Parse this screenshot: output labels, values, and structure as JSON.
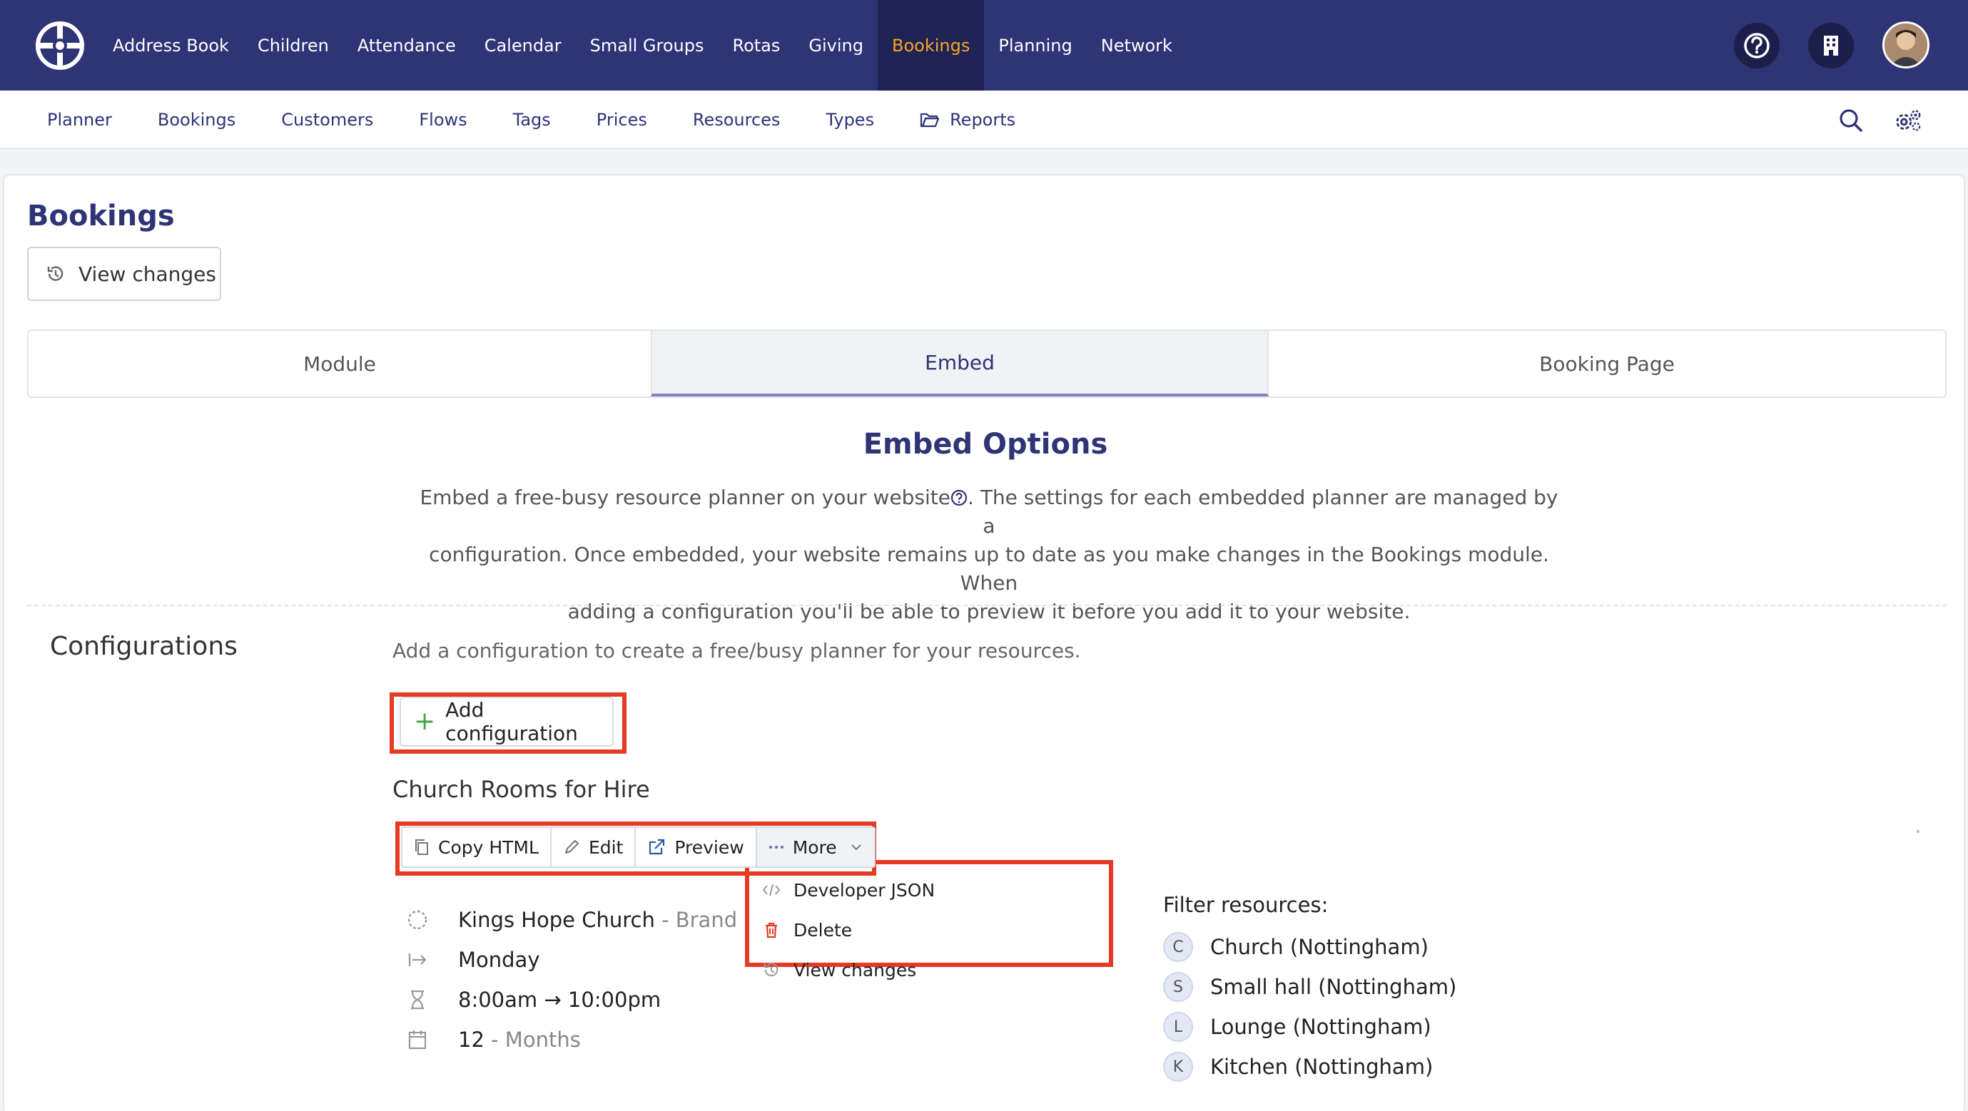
{
  "topnav": {
    "items": [
      "Address Book",
      "Children",
      "Attendance",
      "Calendar",
      "Small Groups",
      "Rotas",
      "Giving",
      "Bookings",
      "Planning",
      "Network"
    ],
    "active": "Bookings"
  },
  "subnav": {
    "items": [
      "Planner",
      "Bookings",
      "Customers",
      "Flows",
      "Tags",
      "Prices",
      "Resources",
      "Types",
      "Reports"
    ]
  },
  "page": {
    "title": "Bookings",
    "view_changes": "View changes"
  },
  "tabs": [
    "Module",
    "Embed",
    "Booking Page"
  ],
  "embed": {
    "title": "Embed Options",
    "desc_line1": "Embed a free-busy resource planner on your website",
    "desc_line1_tail": ". The settings for each embedded planner are managed by a",
    "desc_line2": "configuration. Once embedded, your website remains up to date as you make changes in the Bookings module. When",
    "desc_line3": "adding a configuration you'll be able to preview it before you add it to your website."
  },
  "configurations": {
    "heading": "Configurations",
    "subtext": "Add a configuration to create a free/busy planner for your resources.",
    "add_button": "Add configuration",
    "item": {
      "name": "Church Rooms for Hire",
      "actions": [
        "Copy HTML",
        "Edit",
        "Preview",
        "More"
      ],
      "more_menu": [
        "Developer JSON",
        "Delete",
        "View changes"
      ],
      "brand": "Kings Hope Church",
      "brand_suffix": "- Brand",
      "start_day": "Monday",
      "time_range": "8:00am → 10:00pm",
      "duration_value": "12",
      "duration_unit": "- Months",
      "filter_label": "Filter resources:",
      "resources": [
        {
          "initial": "C",
          "name": "Church (Nottingham)"
        },
        {
          "initial": "S",
          "name": "Small hall (Nottingham)"
        },
        {
          "initial": "L",
          "name": "Lounge (Nottingham)"
        },
        {
          "initial": "K",
          "name": "Kitchen (Nottingham)"
        }
      ]
    }
  },
  "colors": {
    "nav_bg": "#2e3476",
    "active_nav": "#f5a623",
    "highlight": "#e53a24",
    "delete_icon": "#e53a24"
  }
}
